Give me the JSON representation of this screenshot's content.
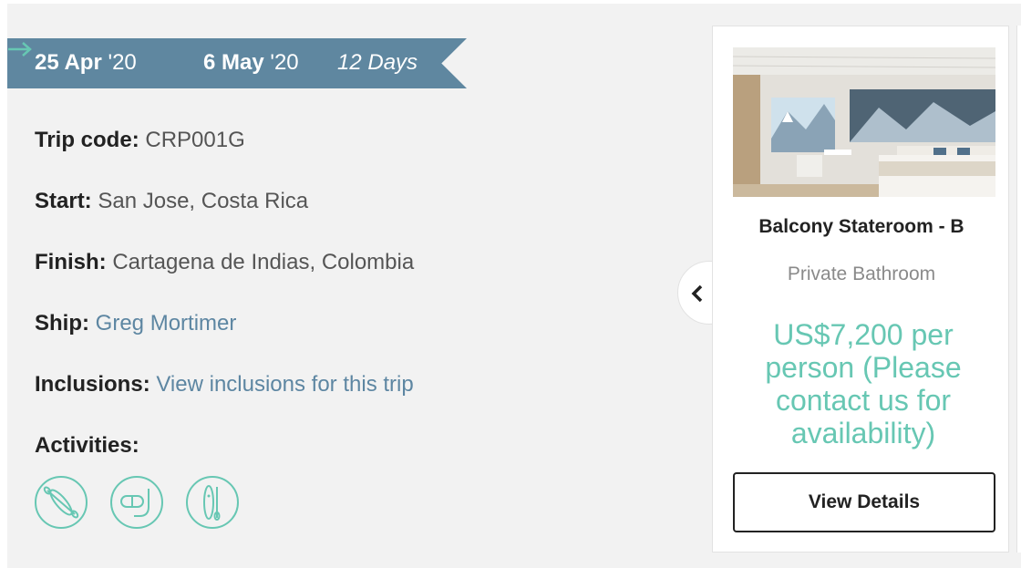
{
  "trip": {
    "start_date": "25 Apr",
    "start_year": "'20",
    "end_date": "6 May",
    "end_year": "'20",
    "duration": "12 Days",
    "code_label": "Trip code:",
    "code": "CRP001G",
    "start_label": "Start:",
    "start": "San Jose, Costa Rica",
    "finish_label": "Finish:",
    "finish": "Cartagena de Indias, Colombia",
    "ship_label": "Ship:",
    "ship": "Greg Mortimer",
    "inclusions_label": "Inclusions:",
    "inclusions_link": "View inclusions for this trip",
    "activities_label": "Activities:",
    "activities": [
      "kayak-icon",
      "snorkel-icon",
      "paddleboard-icon"
    ]
  },
  "cabin": {
    "title": "Balcony Stateroom - B",
    "subtitle": "Private Bathroom",
    "price": "US$7,200 per person (Please contact us for availability)",
    "button_label": "View Details"
  },
  "colors": {
    "ribbon": "#5f87a0",
    "accent": "#67c7b3",
    "link": "#5d86a2",
    "panel": "#f2f2f2"
  }
}
